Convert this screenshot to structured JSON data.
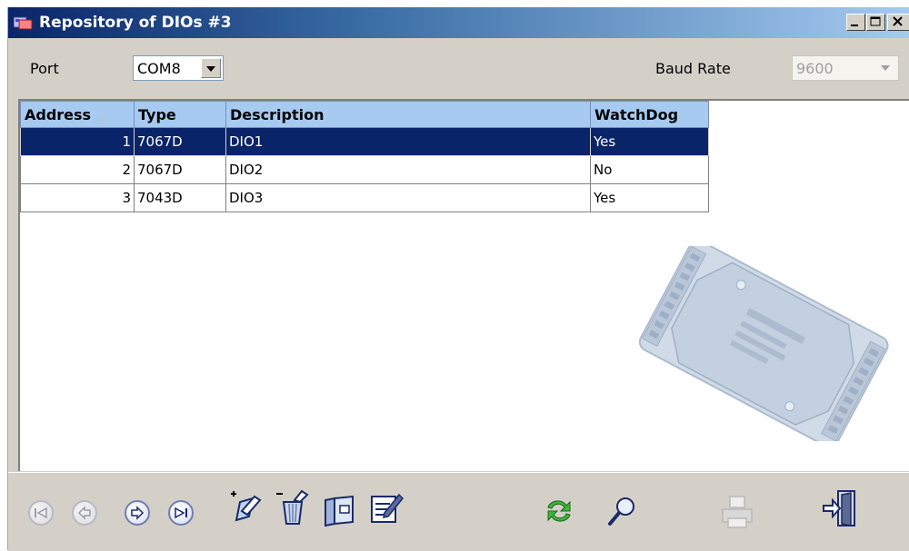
{
  "window": {
    "title": "Repository of DIOs #3",
    "controls": {
      "minimize": "minimize",
      "maximize": "maximize",
      "close": "close"
    }
  },
  "port": {
    "label": "Port",
    "value": "COM8"
  },
  "baud": {
    "label": "Baud Rate",
    "value": "9600",
    "disabled": true
  },
  "grid": {
    "columns": [
      "Address",
      "Type",
      "Description",
      "WatchDog"
    ],
    "sort_column": "Address",
    "rows": [
      {
        "address": "1",
        "type": "7067D",
        "description": "DIO1",
        "watchdog": "Yes",
        "selected": true
      },
      {
        "address": "2",
        "type": "7067D",
        "description": "DIO2",
        "watchdog": "No",
        "selected": false
      },
      {
        "address": "3",
        "type": "7043D",
        "description": "DIO3",
        "watchdog": "Yes",
        "selected": false
      }
    ]
  },
  "toolbar": {
    "icons": [
      "first-record-icon",
      "previous-record-icon",
      "next-record-icon",
      "last-record-icon",
      "add-record-icon",
      "delete-record-icon",
      "open-folder-icon",
      "edit-icon",
      "refresh-icon",
      "search-icon",
      "print-icon",
      "exit-icon"
    ]
  },
  "colors": {
    "title_start": "#0a246a",
    "title_end": "#a6caf0",
    "selection": "#0a246a",
    "header": "#a6caf0",
    "face": "#d4d0c8"
  }
}
